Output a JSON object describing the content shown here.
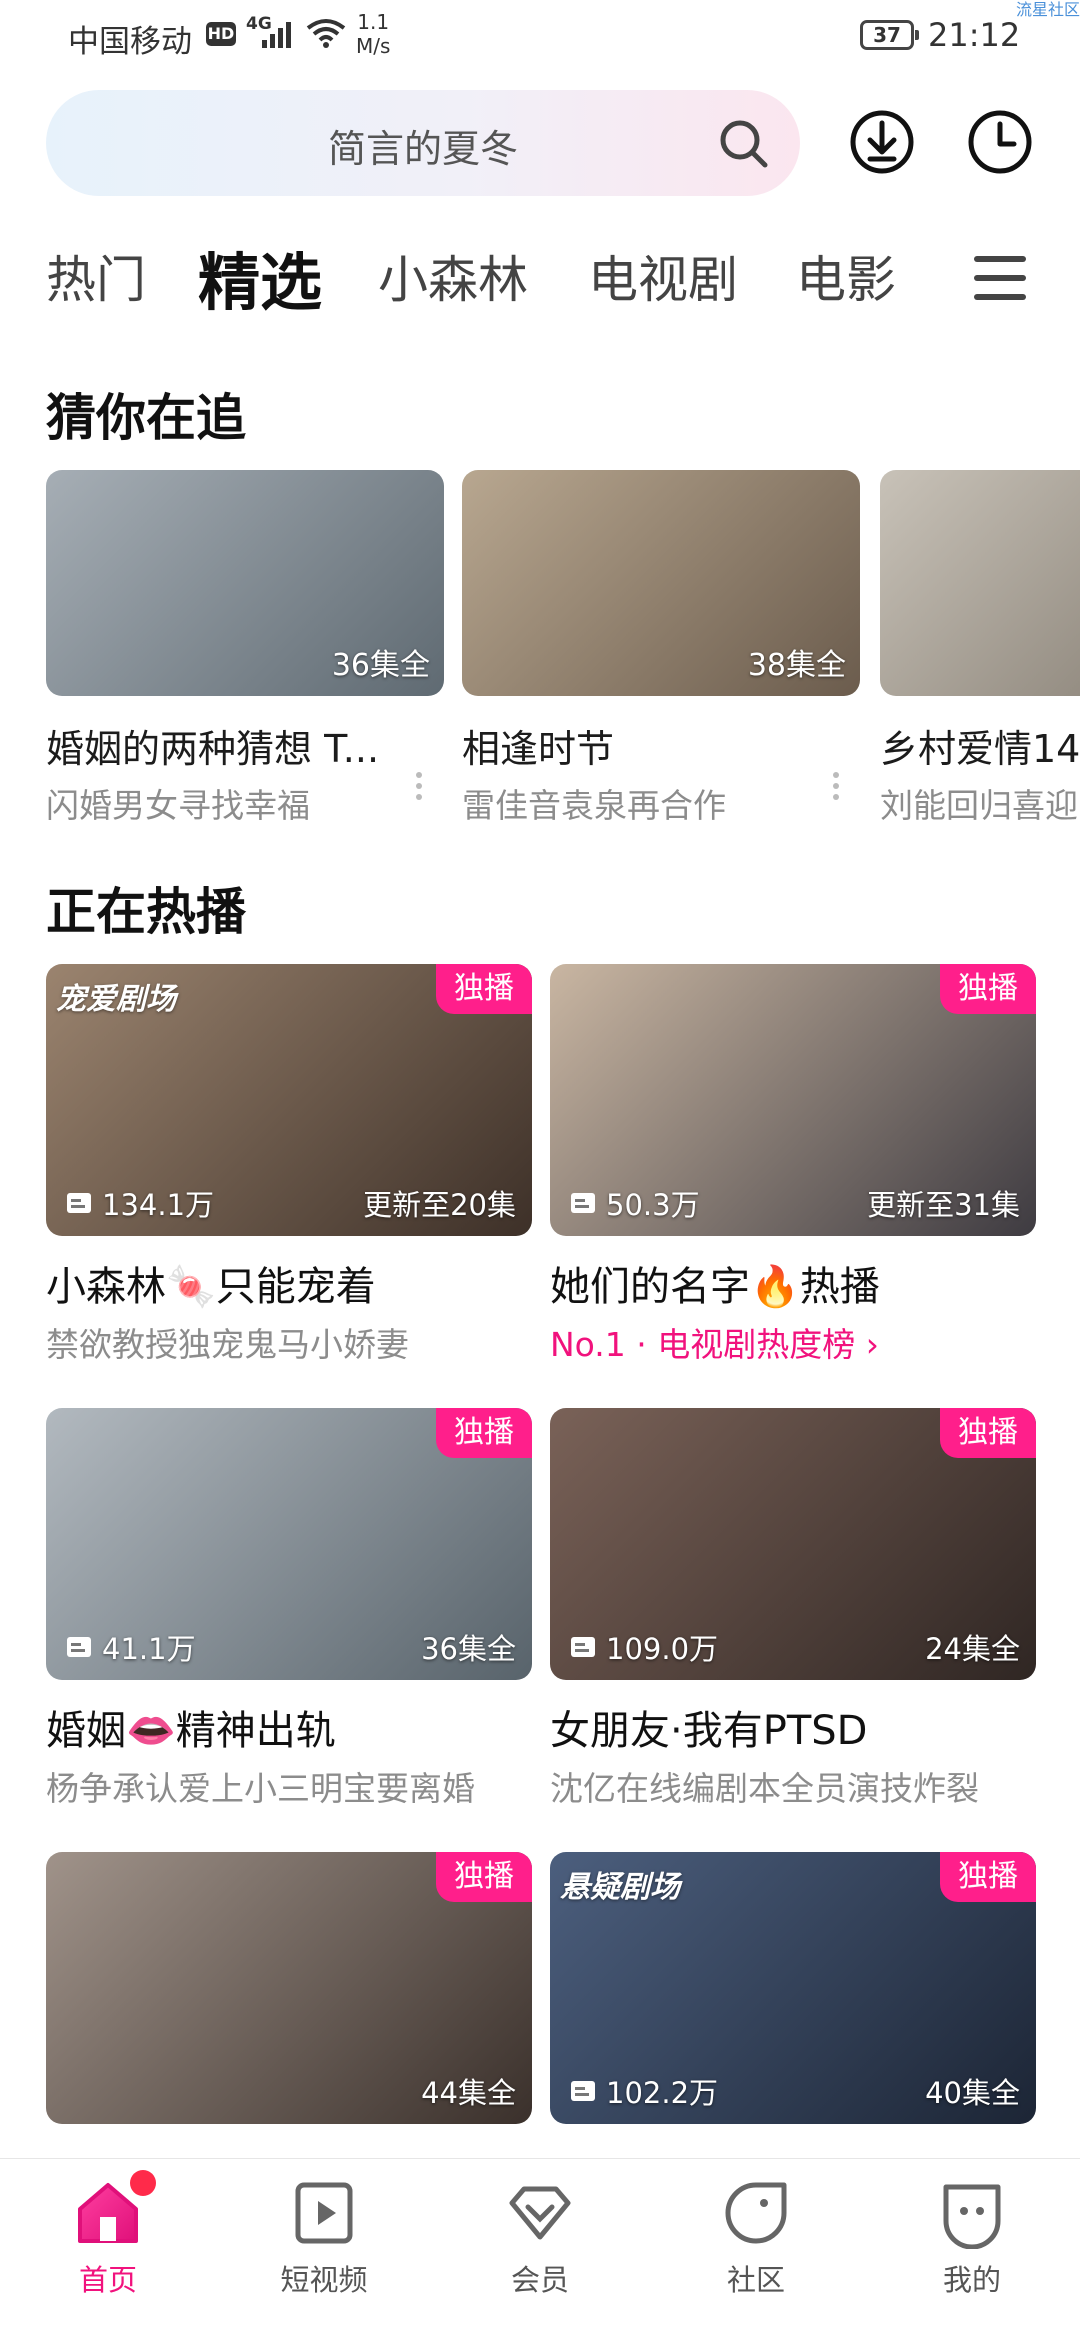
{
  "status_bar": {
    "carrier": "中国移动",
    "hd": "HD",
    "network": "4G",
    "speed_value": "1.1",
    "speed_unit": "M/s",
    "battery": "37",
    "time": "21:12",
    "corner_text": "流星社区"
  },
  "search": {
    "placeholder": "简言的夏冬"
  },
  "category_tabs": [
    "热门",
    "精选",
    "小森林",
    "电视剧",
    "电影"
  ],
  "active_tab": "精选",
  "guess_section": {
    "title": "猜你在追",
    "cards": [
      {
        "title": "婚姻的两种猜想 T...",
        "subtitle": "闪婚男女寻找幸福",
        "episodes": "36集全",
        "thumb_color": "#7d8a93"
      },
      {
        "title": "相逢时节",
        "subtitle": "雷佳音袁泉再合作",
        "episodes": "38集全",
        "thumb_color": "#8a7866"
      },
      {
        "title": "乡村爱情14",
        "subtitle": "刘能回归喜迎",
        "episodes": "",
        "thumb_color": "#9a948a"
      }
    ]
  },
  "hot_section": {
    "title": "正在热播",
    "exclusive_label": "独播",
    "cards": [
      {
        "title": "小森林🍬只能宠着",
        "subtitle": "禁欲教授独宠鬼马小娇妻",
        "views": "134.1万",
        "episodes": "更新至20集",
        "brand": "宠爱剧场",
        "thumb_color": "#6b5a4c"
      },
      {
        "title": "她们的名字🔥热播",
        "subtitle": "No.1 · 电视剧热度榜 ›",
        "views": "50.3万",
        "episodes": "更新至31集",
        "brand": "",
        "thumb_color": "#8b7462",
        "subtitle_pink": true
      },
      {
        "title": "婚姻👄精神出轨",
        "subtitle": "杨争承认爱上小三明宝要离婚",
        "views": "41.1万",
        "episodes": "36集全",
        "brand": "",
        "thumb_color": "#7c8890"
      },
      {
        "title": "女朋友·我有PTSD",
        "subtitle": "沈亿在线编剧本全员演技炸裂",
        "views": "109.0万",
        "episodes": "24集全",
        "brand": "",
        "thumb_color": "#5a4a44"
      },
      {
        "title": "",
        "subtitle": "",
        "views": "",
        "episodes": "44集全",
        "brand": "",
        "thumb_color": "#5e544e"
      },
      {
        "title": "",
        "subtitle": "",
        "views": "102.2万",
        "episodes": "40集全",
        "brand": "悬疑剧场",
        "thumb_color": "#2c3a52"
      }
    ]
  },
  "bottom_nav": [
    {
      "label": "首页",
      "icon": "home-icon",
      "active": true
    },
    {
      "label": "短视频",
      "icon": "short-video-icon",
      "active": false
    },
    {
      "label": "会员",
      "icon": "vip-diamond-icon",
      "active": false
    },
    {
      "label": "社区",
      "icon": "community-icon",
      "active": false
    },
    {
      "label": "我的",
      "icon": "profile-icon",
      "active": false
    }
  ],
  "colors": {
    "accent": "#f1127d",
    "exclusive_badge": "#ff1f8b",
    "notification_dot": "#ff2a4a"
  }
}
